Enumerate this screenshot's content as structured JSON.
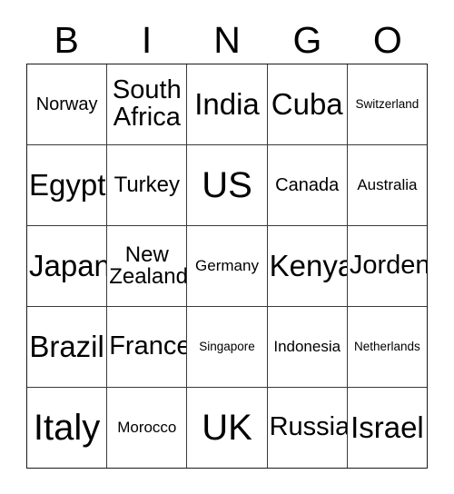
{
  "card": {
    "title": "BINGO",
    "header_letters": [
      "B",
      "I",
      "N",
      "G",
      "O"
    ],
    "columns": 5,
    "rows": 5,
    "colors": {
      "background": "#ffffff",
      "text": "#000000",
      "grid_line": "#3a3a3a",
      "outer_border": "#1a1a1a"
    },
    "cells": [
      [
        {
          "label": "Norway",
          "size": "sm"
        },
        {
          "label": "South\nAfrica",
          "size": "lg"
        },
        {
          "label": "India",
          "size": "xl"
        },
        {
          "label": "Cuba",
          "size": "xl"
        },
        {
          "label": "Switzerland",
          "size": "xxs"
        }
      ],
      [
        {
          "label": "Egypt",
          "size": "xl"
        },
        {
          "label": "Turkey",
          "size": "md"
        },
        {
          "label": "US",
          "size": "xxl"
        },
        {
          "label": "Canada",
          "size": "sm"
        },
        {
          "label": "Australia",
          "size": "xs"
        }
      ],
      [
        {
          "label": "Japan",
          "size": "xl"
        },
        {
          "label": "New\nZealand",
          "size": "md"
        },
        {
          "label": "Germany",
          "size": "xs"
        },
        {
          "label": "Kenya",
          "size": "xl"
        },
        {
          "label": "Jorden",
          "size": "lg"
        }
      ],
      [
        {
          "label": "Brazil",
          "size": "xl"
        },
        {
          "label": "France",
          "size": "lg"
        },
        {
          "label": "Singapore",
          "size": "xxs"
        },
        {
          "label": "Indonesia",
          "size": "xs"
        },
        {
          "label": "Netherlands",
          "size": "xxs"
        }
      ],
      [
        {
          "label": "Italy",
          "size": "xxl"
        },
        {
          "label": "Morocco",
          "size": "xs"
        },
        {
          "label": "UK",
          "size": "xxl"
        },
        {
          "label": "Russia",
          "size": "lg"
        },
        {
          "label": "Israel",
          "size": "xl"
        }
      ]
    ]
  }
}
